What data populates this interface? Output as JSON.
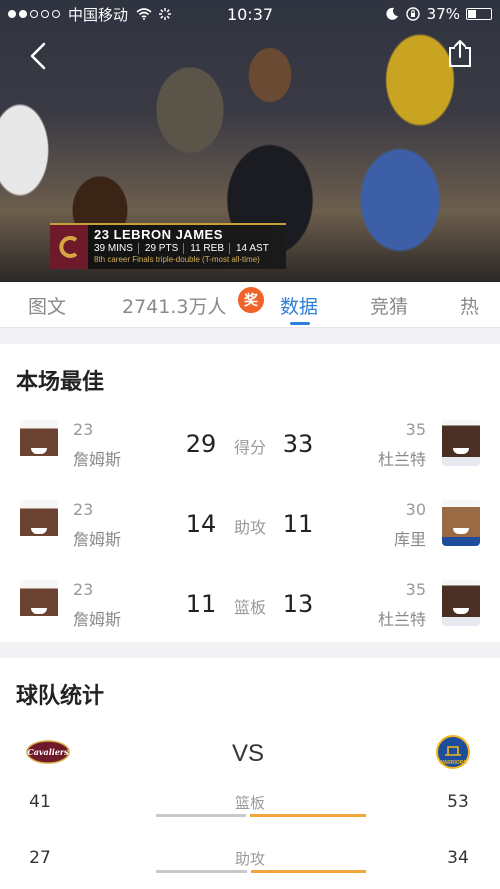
{
  "status_bar": {
    "carrier": "中国移动",
    "time": "10:37",
    "battery": "37%",
    "battery_level": 0.37
  },
  "video": {
    "overlay": {
      "player": "23 LEBRON JAMES",
      "stats": [
        "39 MINS",
        "29 PTS",
        "11 REB",
        "14 AST"
      ],
      "note": "8th career Finals triple-double (T-most all-time)"
    }
  },
  "tabs": [
    {
      "label": "图文",
      "active": false
    },
    {
      "label": "2741.3万人",
      "active": false
    },
    {
      "label": "数据",
      "active": true
    },
    {
      "label": "竞猜",
      "active": false
    },
    {
      "label": "热",
      "active": false
    }
  ],
  "reward_badge": "奖",
  "best_players": {
    "title": "本场最佳",
    "rows": [
      {
        "stat": "得分",
        "left": {
          "number": "23",
          "name": "詹姆斯",
          "value": "29"
        },
        "right": {
          "number": "35",
          "name": "杜兰特",
          "value": "33"
        }
      },
      {
        "stat": "助攻",
        "left": {
          "number": "23",
          "name": "詹姆斯",
          "value": "14"
        },
        "right": {
          "number": "30",
          "name": "库里",
          "value": "11"
        }
      },
      {
        "stat": "篮板",
        "left": {
          "number": "23",
          "name": "詹姆斯",
          "value": "11"
        },
        "right": {
          "number": "35",
          "name": "杜兰特",
          "value": "13"
        }
      }
    ]
  },
  "team_stats": {
    "title": "球队统计",
    "vs": "VS",
    "home_logo_text": "Cavaliers",
    "away_logo_text": "WARRIORS",
    "rows": [
      {
        "label": "篮板",
        "left": "41",
        "right": "53"
      },
      {
        "label": "助攻",
        "left": "27",
        "right": "34"
      }
    ]
  },
  "colors": {
    "accent": "#2d7fd8",
    "badge": "#f0632a",
    "bar_left": "#c9c9c9",
    "bar_right": "#f3a43a"
  }
}
